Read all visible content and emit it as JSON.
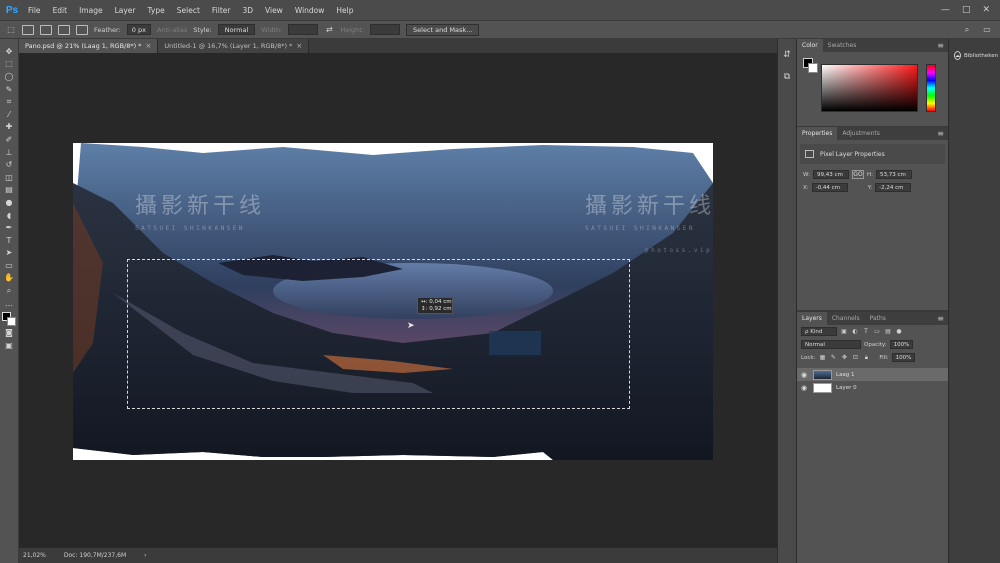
{
  "app": {
    "logo": "Ps"
  },
  "menu": [
    "File",
    "Edit",
    "Image",
    "Layer",
    "Type",
    "Select",
    "Filter",
    "3D",
    "View",
    "Window",
    "Help"
  ],
  "window_controls": {
    "minimize": "—",
    "maximize": "□",
    "close": "✕"
  },
  "options": {
    "feather_label": "Feather:",
    "feather_value": "0 px",
    "antialias_label": "Anti-alias",
    "style_label": "Style:",
    "style_value": "Normal",
    "width_label": "Width:",
    "height_label": "Height:",
    "select_mask_label": "Select and Mask..."
  },
  "tabs": [
    {
      "label": "Pano.psd @ 21% (Laag 1, RGB/8*) *",
      "close": "×"
    },
    {
      "label": "Untitled-1 @ 16,7% (Layer 1, RGB/8*) *",
      "close": "×"
    }
  ],
  "canvas": {
    "watermark_left": "攝影新干线",
    "watermark_left_sub": "SATSUEI SHINKANSEN",
    "watermark_right": "攝影新干线",
    "watermark_right_sub": "SATSUEI SHINKANSEN",
    "watermark_right_tail": "photoss.vip",
    "info_w": "↔: 0,04 cm",
    "info_h": "↕: 0,92 cm"
  },
  "status": {
    "zoom": "21,02%",
    "doc": "Doc: 190,7M/237,6M",
    "arrow": "›"
  },
  "color_panel": {
    "tabs": [
      "Color",
      "Swatches"
    ]
  },
  "properties_panel": {
    "tabs": [
      "Properties",
      "Adjustments"
    ],
    "header": "Pixel Layer Properties",
    "w_label": "W:",
    "w_value": "99,43 cm",
    "h_label": "H:",
    "h_value": "53,73 cm",
    "x_label": "X:",
    "x_value": "-0,44 cm",
    "y_label": "Y:",
    "y_value": "-2,24 cm",
    "link_label": "GO"
  },
  "layers_panel": {
    "tabs": [
      "Layers",
      "Channels",
      "Paths"
    ],
    "kind_label": "ρ Kind",
    "blend_mode": "Normal",
    "opacity_label": "Opacity:",
    "opacity_value": "100%",
    "lock_label": "Lock:",
    "fill_label": "Fill:",
    "fill_value": "100%",
    "layers": [
      {
        "name": "Laag 1"
      },
      {
        "name": "Layer 0"
      }
    ]
  },
  "library_panel": {
    "label": "Bibliotheken"
  },
  "icons": {
    "eye": "👁",
    "menu": "≡"
  }
}
